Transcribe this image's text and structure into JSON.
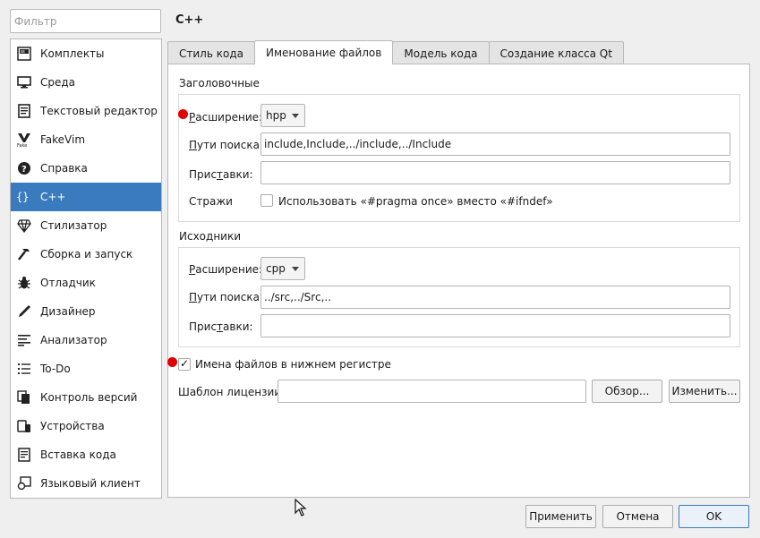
{
  "filter": {
    "placeholder": "Фильтр"
  },
  "sidebar": {
    "items": [
      {
        "label": "Комплекты",
        "icon": "kits-icon"
      },
      {
        "label": "Среда",
        "icon": "monitor-icon"
      },
      {
        "label": "Текстовый редактор",
        "icon": "text-editor-icon"
      },
      {
        "label": "FakeVim",
        "icon": "fakevim-icon"
      },
      {
        "label": "Справка",
        "icon": "help-icon"
      },
      {
        "label": "C++",
        "icon": "cpp-braces-icon",
        "selected": true
      },
      {
        "label": "Стилизатор",
        "icon": "diamond-icon"
      },
      {
        "label": "Сборка и запуск",
        "icon": "hammer-icon"
      },
      {
        "label": "Отладчик",
        "icon": "bug-icon"
      },
      {
        "label": "Дизайнер",
        "icon": "pen-icon"
      },
      {
        "label": "Анализатор",
        "icon": "analyzer-icon"
      },
      {
        "label": "To-Do",
        "icon": "todo-list-icon"
      },
      {
        "label": "Контроль версий",
        "icon": "version-control-icon"
      },
      {
        "label": "Устройства",
        "icon": "devices-icon"
      },
      {
        "label": "Вставка кода",
        "icon": "snippet-icon"
      },
      {
        "label": "Языковый клиент",
        "icon": "language-client-icon"
      }
    ],
    "selected_color": "#3a7bbf"
  },
  "page": {
    "title": "C++"
  },
  "tabs": [
    {
      "label": "Стиль кода"
    },
    {
      "label": "Именование файлов",
      "active": true
    },
    {
      "label": "Модель кода"
    },
    {
      "label": "Создание класса Qt"
    }
  ],
  "headers": {
    "title": "Заголовочные",
    "extension_label": "Расширение:",
    "extension_value": "hpp",
    "search_paths_label": "Пути поиска:",
    "search_paths_value": "include,Include,../include,../Include",
    "prefixes_label": "Приставки:",
    "prefixes_value": "",
    "guards_label": "Стражи",
    "pragma_once_label": "Использовать «#pragma once» вместо «#ifndef»",
    "pragma_once_checked": false
  },
  "sources": {
    "title": "Исходники",
    "extension_label": "Расширение:",
    "extension_value": "cpp",
    "search_paths_label": "Пути поиска:",
    "search_paths_value": "../src,../Src,..",
    "prefixes_label": "Приставки:",
    "prefixes_value": ""
  },
  "lowercase": {
    "label": "Имена файлов в нижнем регистре",
    "checked": true,
    "check_mark": "✓"
  },
  "license": {
    "label": "Шаблон лицензии:",
    "value": "",
    "browse_label": "Обзор...",
    "edit_label": "Изменить..."
  },
  "footer": {
    "apply_label": "Применить",
    "cancel_label": "Отмена",
    "ok_label": "OK"
  },
  "colors": {
    "marker_red": "#e00000",
    "accent": "#3a7bbf"
  }
}
